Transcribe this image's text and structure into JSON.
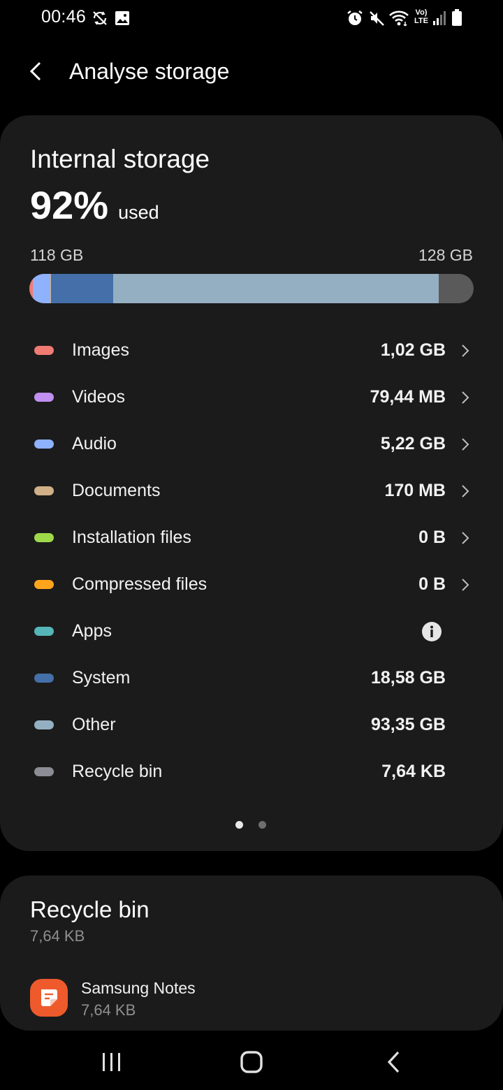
{
  "status_bar": {
    "time": "00:46",
    "left_icons": [
      "sync-off-icon",
      "image-icon"
    ],
    "right_icons": [
      "alarm-icon",
      "mute-icon",
      "wifi-icon",
      "volte-lte-icon",
      "signal-icon",
      "battery-icon"
    ],
    "volte_text": "Vo)",
    "lte_text": "LTE"
  },
  "app_bar": {
    "back_icon": "back-arrow-icon",
    "title": "Analyse storage"
  },
  "storage": {
    "title": "Internal storage",
    "percent": "92%",
    "used_label": "used",
    "used_capacity": "118 GB",
    "total_capacity": "128 GB",
    "categories": [
      {
        "label": "Images",
        "size": "1,02 GB",
        "color": "#f07b73",
        "action": "chevron",
        "bar_fraction": 0.0077
      },
      {
        "label": "Videos",
        "size": "79,44 MB",
        "color": "#c08ff0",
        "action": "chevron",
        "bar_fraction": 0.0006
      },
      {
        "label": "Audio",
        "size": "5,22 GB",
        "color": "#8fb2ff",
        "action": "chevron",
        "bar_fraction": 0.0393
      },
      {
        "label": "Documents",
        "size": "170 MB",
        "color": "#d1b088",
        "action": "chevron",
        "bar_fraction": 0.0013
      },
      {
        "label": "Installation files",
        "size": "0 B",
        "color": "#9ed94a",
        "action": "chevron",
        "bar_fraction": 0
      },
      {
        "label": "Compressed files",
        "size": "0 B",
        "color": "#ffa51c",
        "action": "chevron",
        "bar_fraction": 0
      },
      {
        "label": "Apps",
        "size": "",
        "color": "#55b5b8",
        "action": "info",
        "bar_fraction": 0
      },
      {
        "label": "System",
        "size": "18,58 GB",
        "color": "#446fa8",
        "action": "none",
        "bar_fraction": 0.14
      },
      {
        "label": "Other",
        "size": "93,35 GB",
        "color": "#94afc2",
        "action": "none",
        "bar_fraction": 0.733
      },
      {
        "label": "Recycle bin",
        "size": "7,64 KB",
        "color": "#8c8c94",
        "action": "none",
        "bar_fraction": 0
      }
    ],
    "page_indicator": {
      "count": 2,
      "active": 0
    }
  },
  "recycle_bin": {
    "title": "Recycle bin",
    "size": "7,64 KB",
    "items": [
      {
        "name": "Samsung Notes",
        "size": "7,64 KB",
        "icon": "samsung-notes-icon",
        "icon_color": "#ee5a2c"
      }
    ]
  },
  "nav_bar": {
    "icons": [
      "recent-apps-icon",
      "home-icon",
      "back-icon"
    ]
  }
}
